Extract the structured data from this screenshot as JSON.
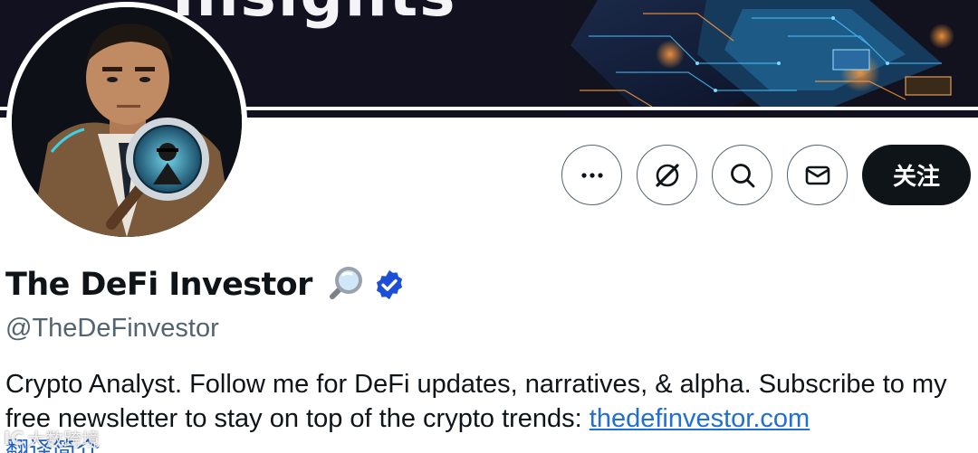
{
  "banner": {
    "title_fragment": "Insights"
  },
  "profile": {
    "display_name": "The DeFi Investor",
    "name_emoji": "magnifying-glass-emoji",
    "verified": true,
    "handle": "@TheDeFinvestor",
    "bio_text": "Crypto Analyst. Follow me for DeFi updates, narratives, & alpha. Subscribe to my free newsletter to stay on top of the crypto trends: ",
    "bio_link": "thedefinvestor.com",
    "translate_label": "翻译简介"
  },
  "actions": {
    "more_icon": "more-icon",
    "grok_icon": "grok-icon",
    "search_icon": "search-icon",
    "message_icon": "envelope-icon",
    "follow_label": "关注"
  },
  "watermark": {
    "mark": "IC",
    "text": "大数跨境"
  },
  "colors": {
    "text_primary": "#0f1419",
    "text_secondary": "#536471",
    "link": "#1f6fd6",
    "verified_badge": "#1d4ed8",
    "follow_bg": "#0f1419"
  }
}
